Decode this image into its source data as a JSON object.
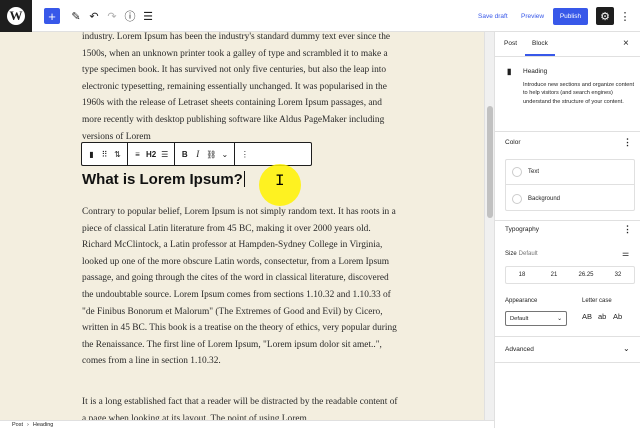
{
  "topbar": {
    "logo": "W",
    "add_label": "+",
    "icons": {
      "edit": "pencil-icon",
      "undo": "undo-icon",
      "redo": "redo-icon",
      "info": "info-icon",
      "list": "list-view-icon",
      "settings": "gear-icon",
      "more": "more-vertical-icon"
    },
    "save_draft": "Save draft",
    "preview": "Preview",
    "publish": "Publish"
  },
  "editor": {
    "paragraph1": "industry. Lorem Ipsum has been the industry's standard dummy text ever since the 1500s, when an unknown printer took a galley of type and scrambled it to make a type specimen book. It has survived not only five centuries, but also the leap into electronic typesetting, remaining essentially unchanged. It was popularised in the 1960s with the release of Letraset sheets containing Lorem Ipsum passages, and more recently with desktop publishing software like Aldus PageMaker including versions of Lorem",
    "heading": "What is Lorem Ipsum?",
    "paragraph2": "Contrary to popular belief, Lorem Ipsum is not simply random text. It has roots in a piece of classical Latin literature from 45 BC, making it over 2000 years old. Richard McClintock, a Latin professor at Hampden-Sydney College in Virginia, looked up one of the more obscure Latin words, consectetur, from a Lorem Ipsum passage, and going through the cites of the word in classical literature, discovered the undoubtable source. Lorem Ipsum comes from sections 1.10.32 and 1.10.33 of \"de Finibus Bonorum et Malorum\" (The Extremes of Good and Evil) by Cicero, written in 45 BC. This book is a treatise on the theory of ethics, very popular during the Renaissance. The first line of Lorem Ipsum, \"Lorem ipsum dolor sit amet..\", comes from a line in section 1.10.32.",
    "paragraph3": "It is a long established fact that a reader will be distracted by the readable content of a page when looking at its layout. The point of using Lorem"
  },
  "block_toolbar": {
    "heading_level": "H2",
    "bold": "B",
    "italic": "I",
    "more": "⋮"
  },
  "footer": {
    "breadcrumb": [
      "Post",
      "Heading"
    ]
  },
  "sidebar": {
    "tabs": {
      "post": "Post",
      "block": "Block"
    },
    "close": "×",
    "block_card": {
      "title": "Heading",
      "description": "Introduce new sections and organize content to help visitors (and search engines) understand the structure of your content."
    },
    "color": {
      "title": "Color",
      "text": "Text",
      "background": "Background"
    },
    "typography": {
      "title": "Typography",
      "size_label": "Size",
      "size_default": "Default",
      "sizes": [
        "18",
        "21",
        "26.25",
        "32"
      ],
      "appearance_label": "Appearance",
      "appearance_value": "Default",
      "letter_case_label": "Letter case",
      "letter_case": [
        "AB",
        "ab",
        "Ab"
      ]
    },
    "advanced": "Advanced"
  },
  "colors": {
    "accent": "#3858e9",
    "canvas": "#f3eedf",
    "dark": "#1e1e1e",
    "highlight": "#fff200"
  }
}
